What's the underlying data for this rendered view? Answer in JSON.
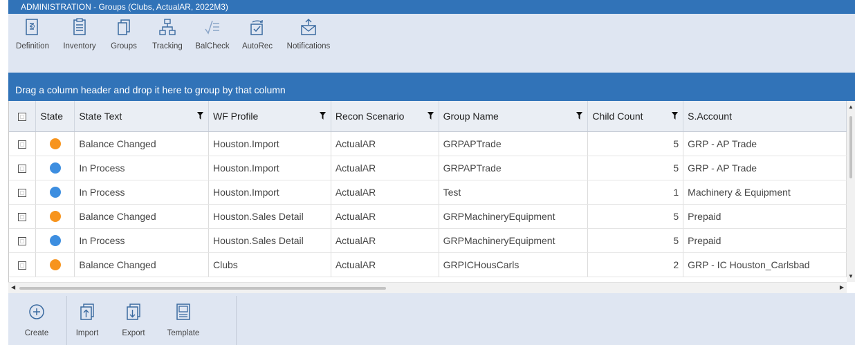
{
  "window": {
    "title": "ADMINISTRATION - Groups  (Clubs, ActualAR, 2022M3)"
  },
  "toolbar": [
    {
      "label": "Definition",
      "icon": "definition-icon"
    },
    {
      "label": "Inventory",
      "icon": "inventory-icon"
    },
    {
      "label": "Groups",
      "icon": "groups-icon"
    },
    {
      "label": "Tracking",
      "icon": "tracking-icon"
    },
    {
      "label": "BalCheck",
      "icon": "balcheck-icon"
    },
    {
      "label": "AutoRec",
      "icon": "autorec-icon"
    },
    {
      "label": "Notifications",
      "icon": "notifications-icon"
    }
  ],
  "group_panel": {
    "text": "Drag a column header and drop it here to group by that column"
  },
  "columns": {
    "state": "State",
    "state_text": "State Text",
    "wf_profile": "WF Profile",
    "recon_scenario": "Recon Scenario",
    "group_name": "Group Name",
    "child_count": "Child Count",
    "s_account": "S.Account"
  },
  "colors": {
    "orange": "#f7941d",
    "blue": "#3d8ee0",
    "accent": "#3173b8"
  },
  "rows": [
    {
      "state": "orange",
      "state_text": "Balance Changed",
      "wf_profile": "Houston.Import",
      "recon_scenario": "ActualAR",
      "group_name": "GRPAPTrade",
      "child_count": "5",
      "s_account": "GRP - AP Trade"
    },
    {
      "state": "blue",
      "state_text": "In Process",
      "wf_profile": "Houston.Import",
      "recon_scenario": "ActualAR",
      "group_name": "GRPAPTrade",
      "child_count": "5",
      "s_account": "GRP - AP Trade"
    },
    {
      "state": "blue",
      "state_text": "In Process",
      "wf_profile": "Houston.Import",
      "recon_scenario": "ActualAR",
      "group_name": "Test",
      "child_count": "1",
      "s_account": "Machinery & Equipment"
    },
    {
      "state": "orange",
      "state_text": "Balance Changed",
      "wf_profile": "Houston.Sales Detail",
      "recon_scenario": "ActualAR",
      "group_name": "GRPMachineryEquipment",
      "child_count": "5",
      "s_account": "Prepaid"
    },
    {
      "state": "blue",
      "state_text": "In Process",
      "wf_profile": "Houston.Sales Detail",
      "recon_scenario": "ActualAR",
      "group_name": "GRPMachineryEquipment",
      "child_count": "5",
      "s_account": "Prepaid"
    },
    {
      "state": "orange",
      "state_text": "Balance Changed",
      "wf_profile": "Clubs",
      "recon_scenario": "ActualAR",
      "group_name": "GRPICHousCarls",
      "child_count": "2",
      "s_account": "GRP - IC Houston_Carlsbad"
    }
  ],
  "bottom_toolbar": [
    {
      "label": "Create",
      "icon": "create-icon"
    },
    {
      "label": "Import",
      "icon": "import-icon"
    },
    {
      "label": "Export",
      "icon": "export-icon"
    },
    {
      "label": "Template",
      "icon": "template-icon"
    }
  ]
}
